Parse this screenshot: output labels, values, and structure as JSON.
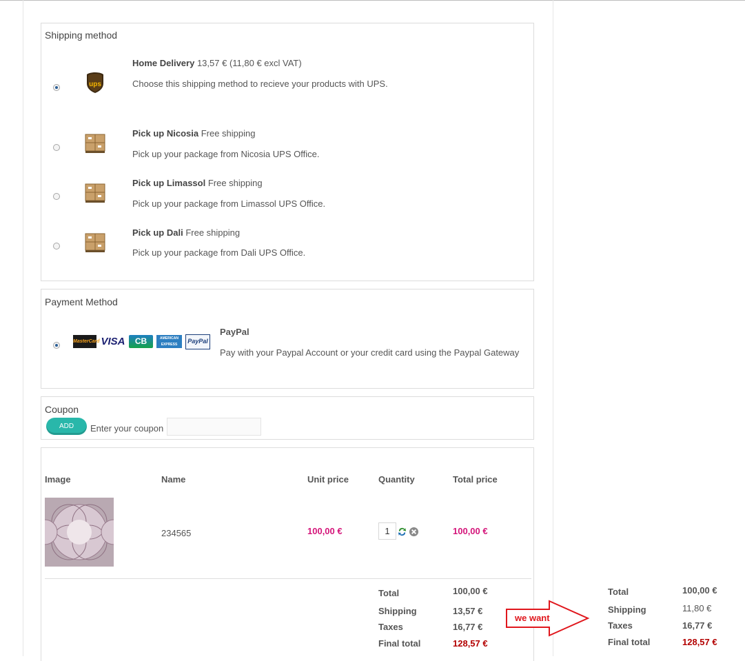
{
  "shipping": {
    "legend": "Shipping method",
    "options": [
      {
        "name": "Home Delivery",
        "price": "13,57 € (11,80 € excl VAT)",
        "desc": " Choose this shipping method to recieve your products with UPS.",
        "selected": true
      },
      {
        "name": "Pick up Nicosia",
        "price": "Free shipping",
        "desc": "Pick up your package from Nicosia UPS Office.",
        "selected": false
      },
      {
        "name": "Pick up Limassol",
        "price": "Free shipping",
        "desc": "Pick up your package from Limassol UPS Office.",
        "selected": false
      },
      {
        "name": "Pick up Dali",
        "price": "Free shipping",
        "desc": "Pick up your package from Dali UPS Office.",
        "selected": false
      }
    ]
  },
  "payment": {
    "legend": "Payment Method",
    "name": "PayPal",
    "desc": "Pay with your Paypal Account or your credit card using the Paypal Gateway",
    "cards": [
      "MasterCard",
      "VISA",
      "CB",
      "AMERICAN EXPRESS",
      "PayPal"
    ]
  },
  "coupon": {
    "legend": "Coupon",
    "button": "ADD",
    "label": "Enter your coupon",
    "value": ""
  },
  "cart": {
    "headers": [
      "Image",
      "Name",
      "Unit price",
      "Quantity",
      "Total price"
    ],
    "item": {
      "name": "234565",
      "unit_price": "100,00 €",
      "quantity": "1",
      "total_price": "100,00 €"
    },
    "summary": {
      "total_label": "Total",
      "total": "100,00 €",
      "shipping_label": "Shipping",
      "shipping": "13,57 €",
      "taxes_label": "Taxes",
      "taxes": "16,77 €",
      "final_label": "Final total",
      "final": "128,57 €"
    }
  },
  "annotation": {
    "text": "we want",
    "summary": {
      "total_label": "Total",
      "total": "100,00 €",
      "shipping_label": "Shipping",
      "shipping": "11,80 €",
      "taxes_label": "Taxes",
      "taxes": "16,77 €",
      "final_label": "Final total",
      "final": "128,57 €"
    }
  },
  "colors": {
    "accent": "#d4157a",
    "final": "#b30000",
    "add_button": "#29b7aa",
    "annotation": "#e0161c"
  }
}
